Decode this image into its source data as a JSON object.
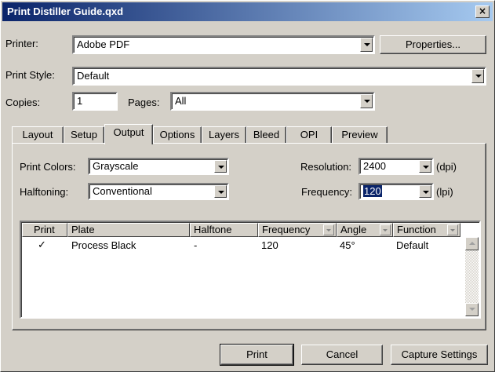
{
  "window": {
    "title": "Print Distiller Guide.qxd",
    "close_glyph": "×"
  },
  "printer": {
    "label": "Printer:",
    "value": "Adobe PDF",
    "properties_label": "Properties..."
  },
  "print_style": {
    "label": "Print Style:",
    "value": "Default"
  },
  "copies": {
    "label": "Copies:",
    "value": "1"
  },
  "pages": {
    "label": "Pages:",
    "value": "All"
  },
  "tabs": [
    {
      "label": "Layout",
      "active": false
    },
    {
      "label": "Setup",
      "active": false
    },
    {
      "label": "Output",
      "active": true
    },
    {
      "label": "Options",
      "active": false
    },
    {
      "label": "Layers",
      "active": false
    },
    {
      "label": "Bleed",
      "active": false
    },
    {
      "label": "OPI",
      "active": false
    },
    {
      "label": "Preview",
      "active": false
    }
  ],
  "output": {
    "print_colors": {
      "label": "Print Colors:",
      "value": "Grayscale"
    },
    "halftoning": {
      "label": "Halftoning:",
      "value": "Conventional"
    },
    "resolution": {
      "label": "Resolution:",
      "value": "2400",
      "unit": "(dpi)"
    },
    "frequency": {
      "label": "Frequency:",
      "value": "120",
      "unit": "(lpi)"
    }
  },
  "plates_table": {
    "columns": [
      "Print",
      "Plate",
      "Halftone",
      "Frequency",
      "Angle",
      "Function"
    ],
    "rows": [
      {
        "print": "✓",
        "plate": "Process Black",
        "halftone": "-",
        "frequency": "120",
        "angle": "45°",
        "function": "Default"
      }
    ]
  },
  "footer": {
    "print_label": "Print",
    "cancel_label": "Cancel",
    "capture_label": "Capture Settings"
  },
  "icons": {
    "dropdown": "dropdown-arrow-icon",
    "check": "checkmark-icon",
    "close": "close-icon"
  }
}
